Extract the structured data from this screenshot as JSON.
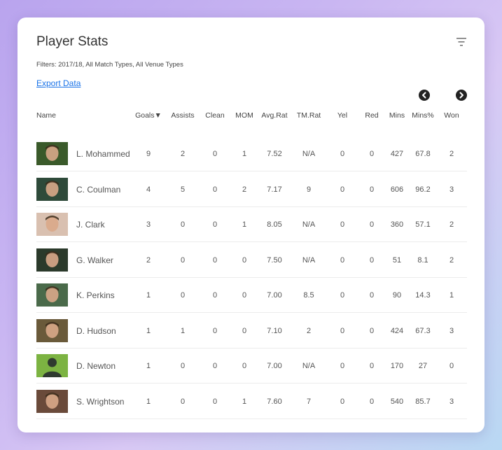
{
  "title": "Player Stats",
  "filters_text": "Filters: 2017/18, All Match Types, All Venue Types",
  "export_label": "Export Data",
  "columns": [
    {
      "key": "name",
      "label": "Name"
    },
    {
      "key": "goals",
      "label": "Goals▼"
    },
    {
      "key": "assists",
      "label": "Assists"
    },
    {
      "key": "clean",
      "label": "Clean"
    },
    {
      "key": "mom",
      "label": "MOM"
    },
    {
      "key": "avg_rat",
      "label": "Avg.Rat"
    },
    {
      "key": "tm_rat",
      "label": "TM.Rat"
    },
    {
      "key": "yel",
      "label": "Yel"
    },
    {
      "key": "red",
      "label": "Red"
    },
    {
      "key": "mins",
      "label": "Mins"
    },
    {
      "key": "mins_pct",
      "label": "Mins%"
    },
    {
      "key": "won",
      "label": "Won"
    }
  ],
  "players": [
    {
      "name": "L. Mohammed",
      "goals": "9",
      "assists": "2",
      "clean": "0",
      "mom": "1",
      "avg_rat": "7.52",
      "tm_rat": "N/A",
      "yel": "0",
      "red": "0",
      "mins": "427",
      "mins_pct": "67.8",
      "won": "2",
      "photo": "#3a5a2a"
    },
    {
      "name": "C. Coulman",
      "goals": "4",
      "assists": "5",
      "clean": "0",
      "mom": "2",
      "avg_rat": "7.17",
      "tm_rat": "9",
      "yel": "0",
      "red": "0",
      "mins": "606",
      "mins_pct": "96.2",
      "won": "3",
      "photo": "#2e4a3a"
    },
    {
      "name": "J. Clark",
      "goals": "3",
      "assists": "0",
      "clean": "0",
      "mom": "1",
      "avg_rat": "8.05",
      "tm_rat": "N/A",
      "yel": "0",
      "red": "0",
      "mins": "360",
      "mins_pct": "57.1",
      "won": "2",
      "photo": "#d9c0b0"
    },
    {
      "name": "G. Walker",
      "goals": "2",
      "assists": "0",
      "clean": "0",
      "mom": "0",
      "avg_rat": "7.50",
      "tm_rat": "N/A",
      "yel": "0",
      "red": "0",
      "mins": "51",
      "mins_pct": "8.1",
      "won": "2",
      "photo": "#2b3a2b"
    },
    {
      "name": "K. Perkins",
      "goals": "1",
      "assists": "0",
      "clean": "0",
      "mom": "0",
      "avg_rat": "7.00",
      "tm_rat": "8.5",
      "yel": "0",
      "red": "0",
      "mins": "90",
      "mins_pct": "14.3",
      "won": "1",
      "photo": "#4a6a4a"
    },
    {
      "name": "D. Hudson",
      "goals": "1",
      "assists": "1",
      "clean": "0",
      "mom": "0",
      "avg_rat": "7.10",
      "tm_rat": "2",
      "yel": "0",
      "red": "0",
      "mins": "424",
      "mins_pct": "67.3",
      "won": "3",
      "photo": "#6a5a3a"
    },
    {
      "name": "D. Newton",
      "goals": "1",
      "assists": "0",
      "clean": "0",
      "mom": "0",
      "avg_rat": "7.00",
      "tm_rat": "N/A",
      "yel": "0",
      "red": "0",
      "mins": "170",
      "mins_pct": "27",
      "won": "0",
      "photo": "#7cb342"
    },
    {
      "name": "S. Wrightson",
      "goals": "1",
      "assists": "0",
      "clean": "0",
      "mom": "1",
      "avg_rat": "7.60",
      "tm_rat": "7",
      "yel": "0",
      "red": "0",
      "mins": "540",
      "mins_pct": "85.7",
      "won": "3",
      "photo": "#6a4a3a"
    }
  ],
  "colors": {
    "link": "#1a73e8",
    "text": "#555555",
    "divider": "#ececec",
    "placeholder_silhouette": "#2f3a2f"
  },
  "icons": {
    "filter": "filter-icon",
    "prev": "chevron-left-icon",
    "next": "chevron-right-icon",
    "avatar_placeholder": "person-silhouette-icon"
  }
}
